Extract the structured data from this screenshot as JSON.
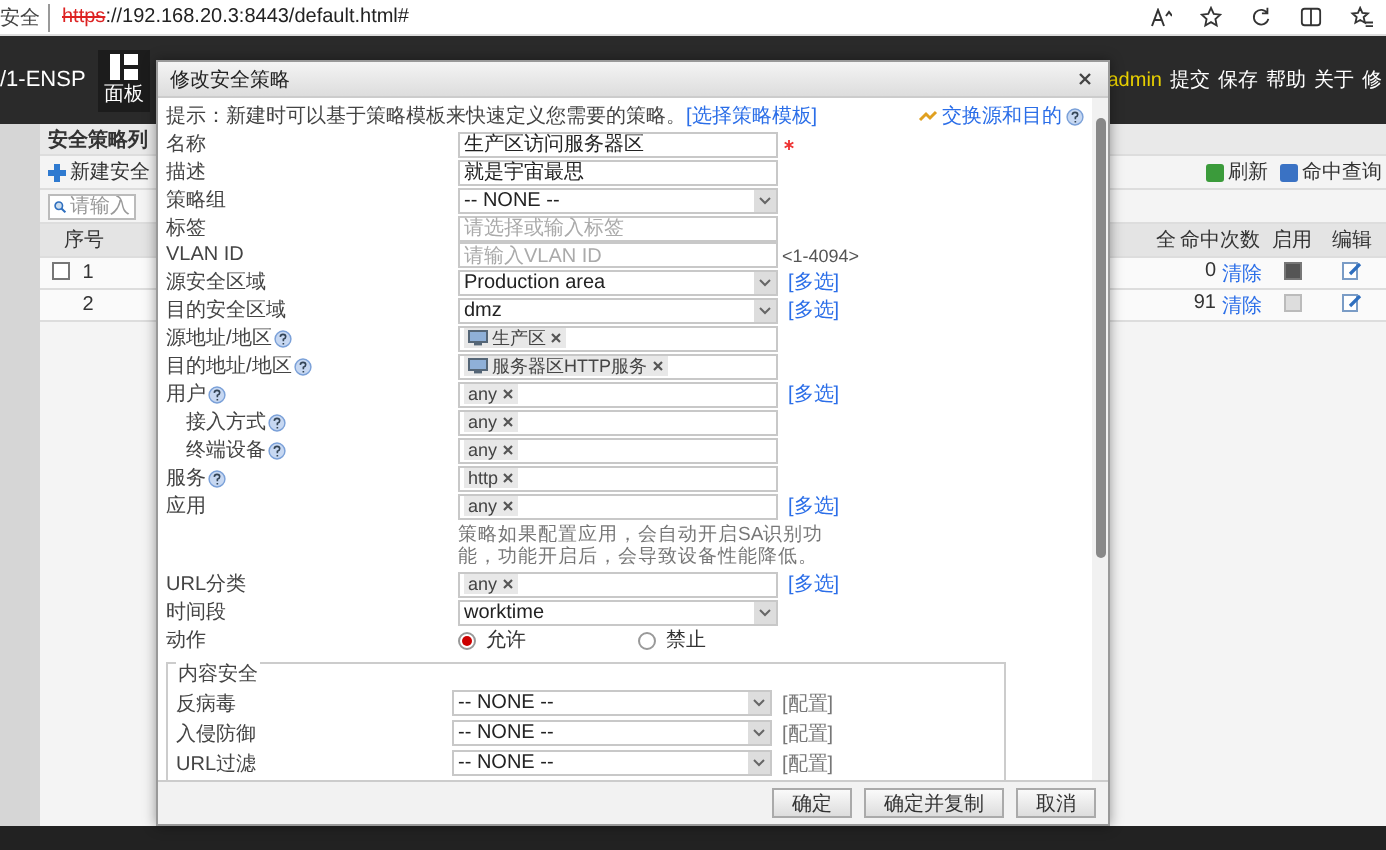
{
  "browser": {
    "security": "安全",
    "url_scheme": "https",
    "url_rest": "://192.168.20.3:8443/default.html#"
  },
  "header": {
    "product": "/1-ENSP",
    "nav": [
      {
        "label": "面板",
        "selected": true
      }
    ],
    "user": "admin",
    "links": [
      "提交",
      "保存",
      "帮助",
      "关于",
      "修"
    ]
  },
  "list_panel": {
    "title": "安全策略列",
    "new_button": "新建安全",
    "search_placeholder": "请输入",
    "tools": [
      "刷新",
      "命中查询"
    ],
    "columns_left": [
      "序号"
    ],
    "columns_right": [
      "全",
      "命中次数",
      "启用",
      "编辑"
    ],
    "rows": [
      {
        "index": "1",
        "kind": "selectable",
        "hits": "0",
        "clear": "清除",
        "enabled": true
      },
      {
        "index": "2",
        "kind": "plain",
        "hits": "91",
        "clear": "清除",
        "enabled": false
      }
    ]
  },
  "dialog": {
    "title": "修改安全策略",
    "hint": "提示：新建时可以基于策略模板来快速定义您需要的策略。",
    "template_link": "[选择策略模板]",
    "swap_link": "交换源和目的",
    "fields": [
      {
        "kind": "text",
        "label": "名称",
        "value": "生产区访问服务器区",
        "required": true
      },
      {
        "kind": "text",
        "label": "描述",
        "value": "就是宇宙最思"
      },
      {
        "kind": "select",
        "label": "策略组",
        "value": "-- NONE --"
      },
      {
        "kind": "text",
        "label": "标签",
        "placeholder": "请选择或输入标签"
      },
      {
        "kind": "text",
        "label": "VLAN ID",
        "placeholder": "请输入VLAN ID",
        "suffix": "<1-4094>"
      },
      {
        "kind": "select",
        "label": "源安全区域",
        "value": "Production area",
        "extra": "[多选]"
      },
      {
        "kind": "select",
        "label": "目的安全区域",
        "value": "dmz",
        "extra": "[多选]"
      },
      {
        "kind": "tags",
        "label": "源地址/地区",
        "help": true,
        "tags": [
          {
            "text": "生产区",
            "kind": "address"
          }
        ]
      },
      {
        "kind": "tags",
        "label": "目的地址/地区",
        "help": true,
        "tags": [
          {
            "text": "服务器区HTTP服务",
            "kind": "address"
          }
        ]
      },
      {
        "kind": "tags",
        "label": "用户",
        "help": true,
        "tags": [
          {
            "text": "any",
            "kind": "plain"
          }
        ],
        "extra": "[多选]"
      },
      {
        "kind": "tags",
        "label": "接入方式",
        "help": true,
        "indent": true,
        "tags": [
          {
            "text": "any",
            "kind": "plain"
          }
        ]
      },
      {
        "kind": "tags",
        "label": "终端设备",
        "help": true,
        "indent": true,
        "tags": [
          {
            "text": "any",
            "kind": "plain"
          }
        ]
      },
      {
        "kind": "tags",
        "label": "服务",
        "help": true,
        "tags": [
          {
            "text": "http",
            "kind": "plain"
          }
        ]
      },
      {
        "kind": "tags",
        "label": "应用",
        "tags": [
          {
            "text": "any",
            "kind": "plain"
          }
        ],
        "extra": "[多选]"
      },
      {
        "kind": "note",
        "text": "策略如果配置应用，会自动开启SA识别功能，功能开启后，会导致设备性能降低。"
      },
      {
        "kind": "tags",
        "label": "URL分类",
        "tags": [
          {
            "text": "any",
            "kind": "plain"
          }
        ],
        "extra": "[多选]"
      },
      {
        "kind": "select",
        "label": "时间段",
        "value": "worktime"
      },
      {
        "kind": "radio",
        "label": "动作",
        "options": [
          {
            "label": "允许",
            "selected": true
          },
          {
            "label": "禁止",
            "selected": false
          }
        ]
      }
    ],
    "content_security": {
      "legend": "内容安全",
      "rows": [
        {
          "label": "反病毒",
          "value": "-- NONE --",
          "extra": "[配置]"
        },
        {
          "label": "入侵防御",
          "value": "-- NONE --",
          "extra": "[配置]"
        },
        {
          "label": "URL过滤",
          "value": "-- NONE --",
          "extra": "[配置]"
        }
      ]
    },
    "buttons": [
      "确定",
      "确定并复制",
      "取消"
    ]
  }
}
